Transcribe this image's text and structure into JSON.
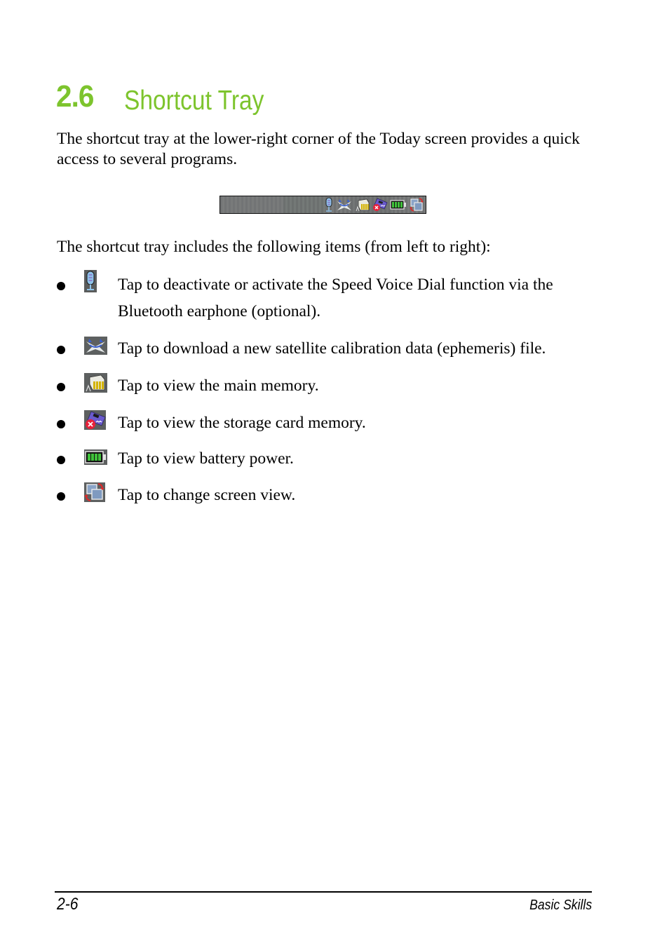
{
  "heading": {
    "number": "2.6",
    "title": "Shortcut Tray",
    "color": "#7dc42d"
  },
  "intro": "The shortcut tray at the lower-right corner of the Today screen provides a quick access to several programs.",
  "tray": {
    "icons": [
      "microphone-icon",
      "satellite-icon",
      "memory-chip-icon",
      "storage-card-icon",
      "battery-icon",
      "screen-rotate-icon"
    ]
  },
  "lead": "The shortcut tray includes the following items (from left to right):",
  "items": [
    {
      "icon": "microphone-icon",
      "text": "Tap to deactivate or activate the Speed Voice Dial function via the Bluetooth earphone (optional)."
    },
    {
      "icon": "satellite-icon",
      "text": "Tap to download a new satellite calibration data (ephemeris) file."
    },
    {
      "icon": "memory-chip-icon",
      "text": "Tap to view the main memory."
    },
    {
      "icon": "storage-card-icon",
      "text": "Tap to view the storage card memory."
    },
    {
      "icon": "battery-icon",
      "text": "Tap to view battery power."
    },
    {
      "icon": "screen-rotate-icon",
      "text": "Tap to change screen view."
    }
  ],
  "footer": {
    "page_number": "2-6",
    "section": "Basic Skills"
  }
}
